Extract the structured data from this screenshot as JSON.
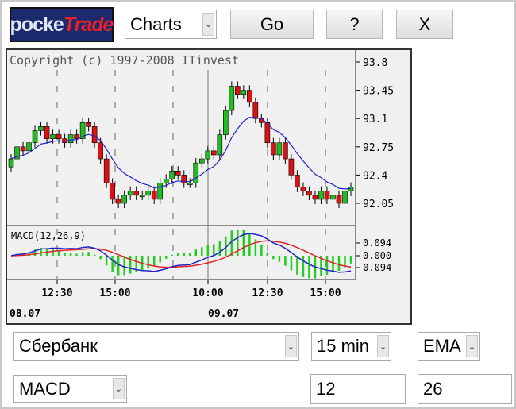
{
  "logo": {
    "text_a": "pocke",
    "text_b": "Trade"
  },
  "toolbar": {
    "mode_select": "Charts",
    "go_label": "Go",
    "help_label": "?",
    "close_label": "X"
  },
  "chart": {
    "copyright": "Copyright (c) 1997-2008 ITinvest",
    "price_ticks": [
      "93.8",
      "93.45",
      "93.1",
      "92.75",
      "92.4",
      "92.05"
    ],
    "macd_label": "MACD(12,26,9)",
    "macd_ticks": [
      "0.094",
      "0.000",
      "-0.094"
    ],
    "time_labels": [
      "12:30",
      "15:00",
      "10:00",
      "12:30",
      "15:00"
    ],
    "date_labels": [
      "08.07",
      "09.07"
    ],
    "colors": {
      "up": "#22bb22",
      "down": "#dd1111",
      "ema": "#2222cc",
      "macd": "#2222cc",
      "signal": "#dd2222",
      "hist": "#22cc22"
    }
  },
  "chart_data": {
    "type": "candlestick",
    "closes": [
      92.6,
      92.75,
      92.7,
      92.8,
      92.95,
      93.0,
      92.85,
      92.9,
      92.85,
      92.8,
      92.9,
      92.85,
      93.05,
      93.0,
      92.8,
      92.6,
      92.3,
      92.1,
      92.05,
      92.15,
      92.2,
      92.15,
      92.15,
      92.2,
      92.1,
      92.3,
      92.35,
      92.45,
      92.4,
      92.3,
      92.3,
      92.55,
      92.6,
      92.7,
      92.65,
      92.9,
      93.2,
      93.5,
      93.4,
      93.45,
      93.3,
      93.1,
      93.05,
      92.8,
      92.65,
      92.8,
      92.6,
      92.4,
      92.25,
      92.2,
      92.15,
      92.1,
      92.2,
      92.1,
      92.15,
      92.05,
      92.2,
      92.25
    ],
    "ylim": [
      91.9,
      93.9
    ]
  },
  "controls": {
    "security": "Сбербанк",
    "interval": "15 min",
    "ma_type": "EMA",
    "indicator": "MACD",
    "param1": "12",
    "param2": "26"
  }
}
